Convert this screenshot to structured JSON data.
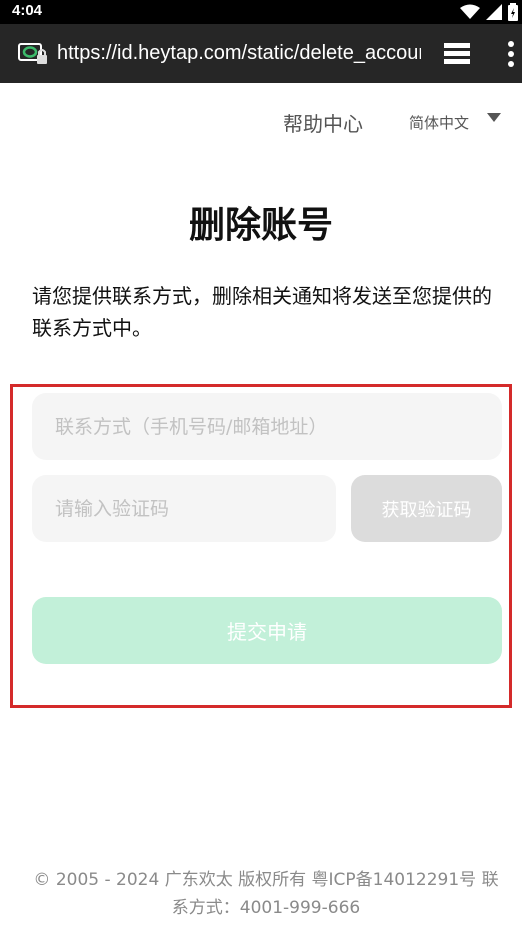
{
  "status_bar": {
    "time": "4:04",
    "icons": [
      "wifi-icon",
      "signal-icon",
      "battery-icon"
    ]
  },
  "browser": {
    "url": "https://id.heytap.com/static/delete_account",
    "icons": [
      "site-security-icon",
      "tabs-icon",
      "overflow-menu-icon"
    ]
  },
  "header": {
    "help_label": "帮助中心",
    "language_label": "简体中文"
  },
  "main": {
    "title": "删除账号",
    "intro": "请您提供联系方式，删除相关通知将发送至您提供的联系方式中。"
  },
  "form": {
    "contact_placeholder": "联系方式（手机号码/邮箱地址）",
    "contact_value": "",
    "code_placeholder": "请输入验证码",
    "code_value": "",
    "get_code_label": "获取验证码",
    "submit_label": "提交申请"
  },
  "footer": {
    "text": "© 2005 - 2024 广东欢太 版权所有 粤ICP备14012291号 联系方式：4001-999-666"
  },
  "colors": {
    "status_bar": "#000000",
    "url_bar": "#262626",
    "input_bg": "#f5f5f5",
    "get_code_bg": "#dcdcdc",
    "submit_bg": "#c2f0d9",
    "highlight_frame": "#d42a2a"
  }
}
